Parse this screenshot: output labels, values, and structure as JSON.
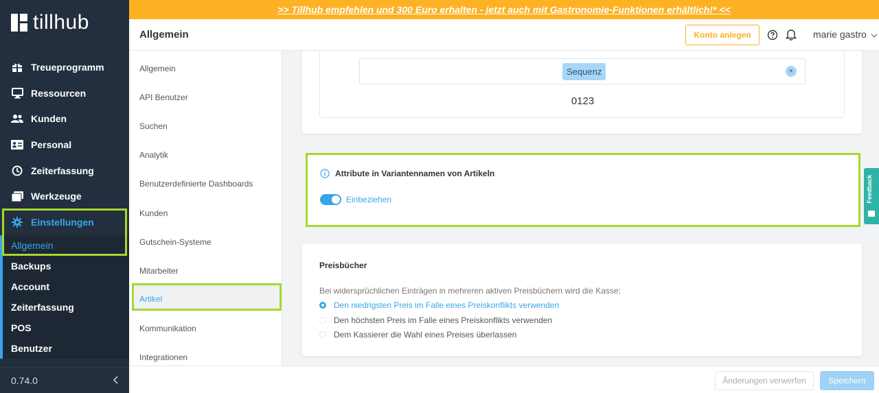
{
  "brand": {
    "logo_text": "tillhub"
  },
  "banner": {
    "text": ">> Tillhub empfehlen und 300 Euro erhalten - jetzt auch mit Gastronomie-Funktionen erhältlich!* <<",
    "color": "#fdb123"
  },
  "sidebar": {
    "items": [
      {
        "label": "Treueprogramm",
        "icon": "gift-icon"
      },
      {
        "label": "Ressourcen",
        "icon": "monitor-icon"
      },
      {
        "label": "Kunden",
        "icon": "users-icon"
      },
      {
        "label": "Personal",
        "icon": "id-card-icon"
      },
      {
        "label": "Zeiterfassung",
        "icon": "clock-icon"
      },
      {
        "label": "Werkzeuge",
        "icon": "folder-icon"
      }
    ],
    "settings": {
      "label": "Einstellungen",
      "icon": "gear-icon"
    },
    "subitems": [
      "Allgemein",
      "Backups",
      "Account",
      "Zeiterfassung",
      "POS",
      "Benutzer"
    ],
    "version": "0.74.0",
    "accent": "#37a6e9"
  },
  "header": {
    "title": "Allgemein",
    "konto_button": "Konto anlegen",
    "user_name": "marie gastro"
  },
  "secondary_nav": {
    "items": [
      "Allgemein",
      "API Benutzer",
      "Suchen",
      "Analytik",
      "Benutzerdefinierte Dashboards",
      "Kunden",
      "Gutschein-Systeme",
      "Mitarbeiter",
      "Artikel",
      "Kommunikation",
      "Integrationen"
    ],
    "active": "Artikel"
  },
  "sequence_card": {
    "tag": "Sequenz",
    "clear": "×",
    "preview": "0123"
  },
  "attribute_card": {
    "title": "Attribute in Variantennamen von Artikeln",
    "toggle_label": "Einbeziehen",
    "toggle_on": true
  },
  "pricebook_card": {
    "title": "Preisbücher",
    "description": "Bei widersprüchlichen Einträgen in mehreren aktiven Preisbüchern wird die Kasse:",
    "options": [
      {
        "label": "Den niedrigsten Preis im Falle eines Preiskonflikts verwenden",
        "checked": true
      },
      {
        "label": "Den höchsten Preis im Falle eines Preiskonflikts verwenden",
        "checked": false
      },
      {
        "label": "Dem Kassierer die Wahl eines Preises überlassen",
        "checked": false
      }
    ]
  },
  "feedback": {
    "label": "Feedback"
  },
  "footer": {
    "discard_button": "Änderungen verwerfen",
    "save_button": "Speichern"
  }
}
